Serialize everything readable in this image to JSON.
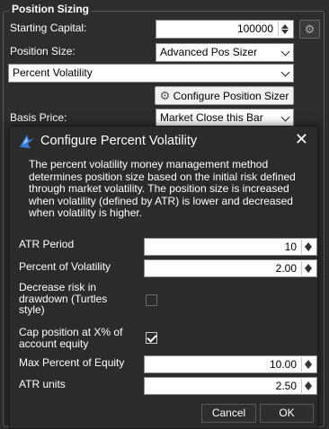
{
  "background": {
    "group_title": "Position Sizing",
    "starting_capital_label": "Starting Capital:",
    "starting_capital_value": "100000",
    "position_size_label": "Position Size:",
    "position_size_value": "Advanced Pos Sizer",
    "method_value": "Percent Volatility",
    "configure_button": "Configure Position Sizer",
    "basis_price_label": "Basis Price:",
    "basis_price_value": "Market Close this Bar"
  },
  "dialog": {
    "title": "Configure Percent Volatility",
    "close_glyph": "✕",
    "description": "The percent volatility money management method determines position size based on the initial risk defined through market volatility. The position size is increased when volatility (defined by ATR) is lower and decreased when volatility is higher.",
    "fields": {
      "atr_period": {
        "label": "ATR Period",
        "value": "10"
      },
      "percent_volatility": {
        "label": "Percent of Volatility",
        "value": "2.00"
      },
      "decrease_risk": {
        "label": "Decrease risk in drawdown (Turtles style)",
        "checked": false
      },
      "cap_position": {
        "label": "Cap position at X% of account equity",
        "checked": true
      },
      "max_percent_equity": {
        "label": "Max Percent of Equity",
        "value": "10.00"
      },
      "atr_units": {
        "label": "ATR units",
        "value": "2.50"
      }
    },
    "cancel_label": "Cancel",
    "ok_label": "OK"
  },
  "colors": {
    "accent": "#3a7bd5",
    "dialog_bg": "#2b2b2b",
    "panel_bg": "#2d2d2d"
  }
}
